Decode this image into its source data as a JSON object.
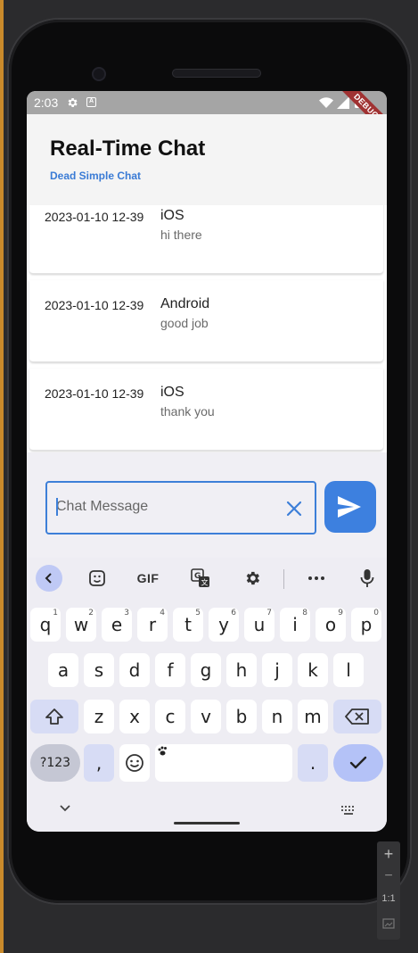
{
  "status_bar": {
    "time": "2:03",
    "debug_banner": "DEBUG",
    "icons": [
      "gear-icon",
      "keyboard-a-icon",
      "wifi-icon",
      "signal-icon",
      "battery-icon"
    ]
  },
  "header": {
    "title": "Real-Time Chat",
    "subtitle": "Dead Simple Chat"
  },
  "messages": [
    {
      "timestamp": "2023-01-10 12-39",
      "author": "iOS",
      "text": "hi there"
    },
    {
      "timestamp": "2023-01-10 12-39",
      "author": "Android",
      "text": "good job"
    },
    {
      "timestamp": "2023-01-10 12-39",
      "author": "iOS",
      "text": "thank you"
    }
  ],
  "composer": {
    "placeholder": "Chat Message",
    "value": "",
    "clear_icon": "close-icon",
    "send_icon": "send-icon"
  },
  "keyboard": {
    "toolbar": {
      "gif_label": "GIF",
      "icons": [
        "chevron-left-icon",
        "sticker-icon",
        "gif-icon",
        "translate-icon",
        "settings-icon",
        "more-icon",
        "microphone-icon"
      ]
    },
    "row1": [
      {
        "key": "q",
        "hint": "1"
      },
      {
        "key": "w",
        "hint": "2"
      },
      {
        "key": "e",
        "hint": "3"
      },
      {
        "key": "r",
        "hint": "4"
      },
      {
        "key": "t",
        "hint": "5"
      },
      {
        "key": "y",
        "hint": "6"
      },
      {
        "key": "u",
        "hint": "7"
      },
      {
        "key": "i",
        "hint": "8"
      },
      {
        "key": "o",
        "hint": "9"
      },
      {
        "key": "p",
        "hint": "0"
      }
    ],
    "row2": [
      "a",
      "s",
      "d",
      "f",
      "g",
      "h",
      "j",
      "k",
      "l"
    ],
    "row3": [
      "z",
      "x",
      "c",
      "v",
      "b",
      "n",
      "m"
    ],
    "symbols_label": "?123",
    "comma_label": ",",
    "period_label": ".",
    "accent_color": "#3d80df"
  },
  "emulator_tools": {
    "zoom_in": "+",
    "zoom_out": "−",
    "one_to_one": "1:1"
  }
}
